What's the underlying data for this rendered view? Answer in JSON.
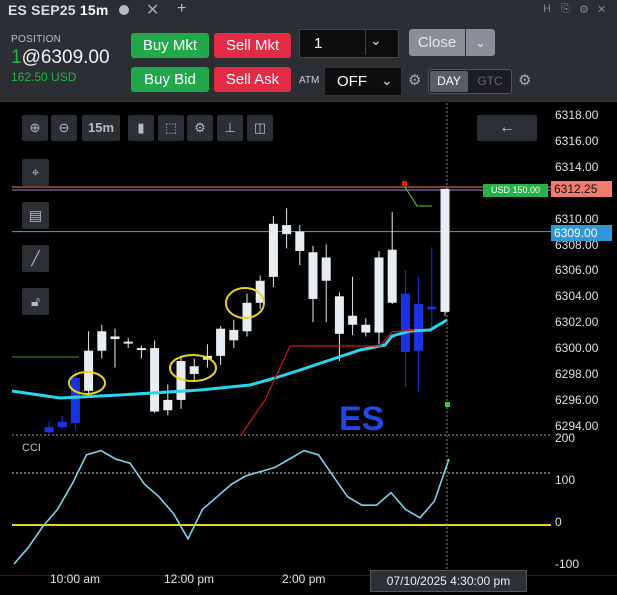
{
  "window": {
    "title": "ES SEP25",
    "timeframe": "15m",
    "status_dot_color": "#bbbbbb",
    "close_glyph": "✕",
    "add_glyph": "+",
    "icons": [
      "h-icon",
      "pin-icon",
      "gear-icon",
      "close-icon"
    ]
  },
  "position": {
    "label": "POSITION",
    "quantity": "1",
    "price": "@6309.00",
    "pnl": "162.50 USD"
  },
  "buttons": {
    "buy_mkt": "Buy Mkt",
    "sell_mkt": "Sell Mkt",
    "buy_bid": "Buy Bid",
    "sell_ask": "Sell Ask",
    "close": "Close"
  },
  "order_qty": "1",
  "atm": {
    "label": "ATM",
    "value": "OFF"
  },
  "tif": {
    "day": "DAY",
    "gtc": "GTC",
    "selected": "DAY"
  },
  "chart_toolbar": {
    "timeframe_label": "15m",
    "back_glyph": "←"
  },
  "price_axis": [
    "6318.00",
    "6316.00",
    "6314.00",
    "6312.00",
    "6310.00",
    "6308.00",
    "6306.00",
    "6304.00",
    "6302.00",
    "6300.00",
    "6298.00",
    "6296.00",
    "6294.00"
  ],
  "last_price_tag": "6312.25",
  "avg_price_tag": "6309.00",
  "pnl_tag": "USD 150.00",
  "symbol_watermark": "ES",
  "cci": {
    "label": "CCI",
    "axis": [
      "200",
      "100",
      "0",
      "-100"
    ]
  },
  "time_axis": [
    "10:00 am",
    "12:00 pm",
    "2:00 pm"
  ],
  "crosshair_time": "07/10/2025 4:30:00 pm",
  "colors": {
    "up_candle": "#e8edf2",
    "down_candle": "#1a33e6",
    "ma_line": "#27d7f0",
    "stop_line": "#d01818",
    "cci_line": "#7ad3ef",
    "zero_line": "#e6d21a",
    "avg_line": "#2f98d8",
    "last_line": "#f07b6e"
  },
  "chart_data": {
    "type": "candlestick",
    "ylim": [
      6293,
      6319
    ],
    "candles": [
      {
        "o": 6293.9,
        "h": 6294.3,
        "l": 6293.4,
        "c": 6293.5,
        "dir": "down"
      },
      {
        "o": 6294.3,
        "h": 6294.8,
        "l": 6293.8,
        "c": 6293.9,
        "dir": "down"
      },
      {
        "o": 6294.2,
        "h": 6298.3,
        "l": 6293.7,
        "c": 6297.7,
        "dir": "down"
      },
      {
        "o": 6296.7,
        "h": 6301.3,
        "l": 6296.2,
        "c": 6299.8,
        "dir": "up"
      },
      {
        "o": 6299.8,
        "h": 6301.8,
        "l": 6299.2,
        "c": 6301.3,
        "dir": "up"
      },
      {
        "o": 6300.9,
        "h": 6301.5,
        "l": 6298.5,
        "c": 6300.7,
        "dir": "up"
      },
      {
        "o": 6300.4,
        "h": 6300.8,
        "l": 6300.0,
        "c": 6300.5,
        "dir": "up"
      },
      {
        "o": 6299.9,
        "h": 6300.2,
        "l": 6299.2,
        "c": 6300.0,
        "dir": "up"
      },
      {
        "o": 6300.0,
        "h": 6300.6,
        "l": 6295.0,
        "c": 6295.1,
        "dir": "up"
      },
      {
        "o": 6295.2,
        "h": 6297.2,
        "l": 6294.8,
        "c": 6296.0,
        "dir": "up"
      },
      {
        "o": 6296.0,
        "h": 6299.3,
        "l": 6295.3,
        "c": 6299.0,
        "dir": "up"
      },
      {
        "o": 6298.0,
        "h": 6299.2,
        "l": 6297.5,
        "c": 6298.6,
        "dir": "up"
      },
      {
        "o": 6299.1,
        "h": 6300.3,
        "l": 6298.5,
        "c": 6299.4,
        "dir": "up"
      },
      {
        "o": 6299.4,
        "h": 6301.7,
        "l": 6298.7,
        "c": 6301.5,
        "dir": "up"
      },
      {
        "o": 6300.6,
        "h": 6302.2,
        "l": 6300.0,
        "c": 6301.4,
        "dir": "up"
      },
      {
        "o": 6301.3,
        "h": 6304.2,
        "l": 6300.9,
        "c": 6303.5,
        "dir": "up"
      },
      {
        "o": 6303.5,
        "h": 6305.6,
        "l": 6303.0,
        "c": 6305.2,
        "dir": "up"
      },
      {
        "o": 6305.5,
        "h": 6310.2,
        "l": 6304.7,
        "c": 6309.6,
        "dir": "up"
      },
      {
        "o": 6309.5,
        "h": 6310.8,
        "l": 6307.7,
        "c": 6308.8,
        "dir": "up"
      },
      {
        "o": 6309.0,
        "h": 6309.5,
        "l": 6306.4,
        "c": 6307.5,
        "dir": "up"
      },
      {
        "o": 6307.4,
        "h": 6307.9,
        "l": 6302.0,
        "c": 6303.8,
        "dir": "up"
      },
      {
        "o": 6305.2,
        "h": 6308.0,
        "l": 6302.0,
        "c": 6307.0,
        "dir": "up"
      },
      {
        "o": 6304.0,
        "h": 6304.3,
        "l": 6299.0,
        "c": 6301.1,
        "dir": "up"
      },
      {
        "o": 6302.5,
        "h": 6305.5,
        "l": 6301.0,
        "c": 6301.8,
        "dir": "up"
      },
      {
        "o": 6301.8,
        "h": 6302.3,
        "l": 6300.9,
        "c": 6301.2,
        "dir": "up"
      },
      {
        "o": 6301.2,
        "h": 6307.5,
        "l": 6300.3,
        "c": 6307.0,
        "dir": "up"
      },
      {
        "o": 6307.6,
        "h": 6310.5,
        "l": 6303.4,
        "c": 6303.5,
        "dir": "up"
      },
      {
        "o": 6304.2,
        "h": 6306.0,
        "l": 6297.0,
        "c": 6299.7,
        "dir": "down"
      },
      {
        "o": 6303.4,
        "h": 6305.5,
        "l": 6296.6,
        "c": 6299.8,
        "dir": "down"
      },
      {
        "o": 6303.2,
        "h": 6307.8,
        "l": 6301.5,
        "c": 6303.0,
        "dir": "down"
      },
      {
        "o": 6302.8,
        "h": 6312.3,
        "l": 6302.5,
        "c": 6312.3,
        "dir": "up"
      }
    ],
    "cci_values": [
      -100,
      -60,
      -10,
      30,
      90,
      160,
      170,
      150,
      140,
      90,
      60,
      20,
      -40,
      30,
      60,
      90,
      110,
      120,
      130,
      150,
      170,
      160,
      110,
      60,
      40,
      40,
      70,
      30,
      10,
      50,
      150
    ]
  }
}
